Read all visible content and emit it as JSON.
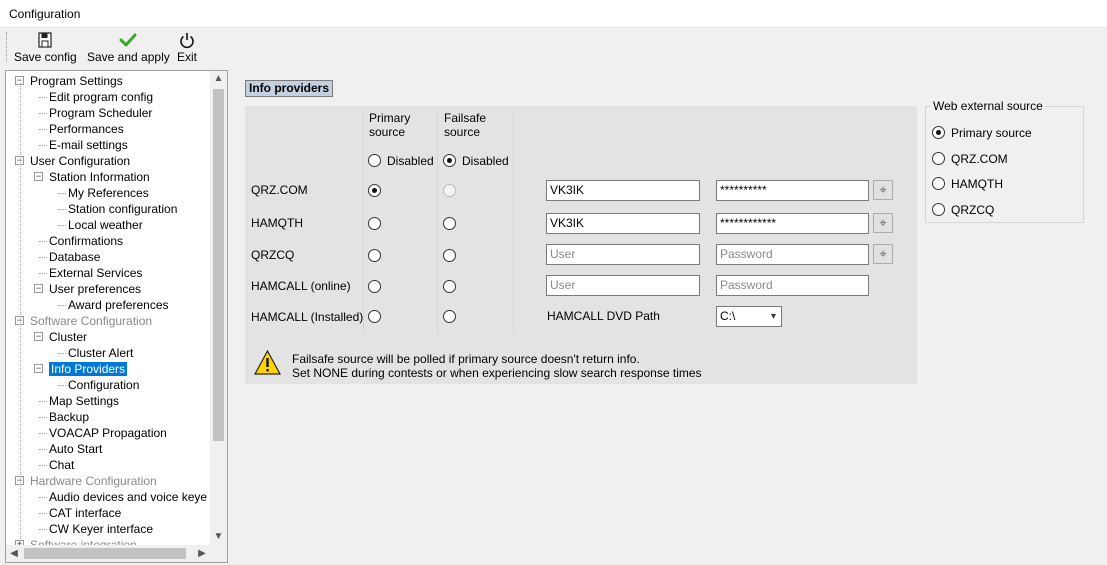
{
  "window": {
    "title": "Configuration"
  },
  "toolbar": {
    "save_config": "Save config",
    "save_apply": "Save and apply",
    "exit": "Exit"
  },
  "tree": {
    "items": [
      {
        "label": "Program Settings",
        "level": 0,
        "expander": "−",
        "style": "normal"
      },
      {
        "label": "Edit program config",
        "level": 1
      },
      {
        "label": "Program Scheduler",
        "level": 1
      },
      {
        "label": "Performances",
        "level": 1
      },
      {
        "label": "E-mail settings",
        "level": 1
      },
      {
        "label": "User Configuration",
        "level": 0,
        "expander": "−"
      },
      {
        "label": "Station Information",
        "level": 1,
        "expander": "−"
      },
      {
        "label": "My References",
        "level": 2
      },
      {
        "label": "Station configuration",
        "level": 2
      },
      {
        "label": "Local weather",
        "level": 2
      },
      {
        "label": "Confirmations",
        "level": 1
      },
      {
        "label": "Database",
        "level": 1
      },
      {
        "label": "External Services",
        "level": 1
      },
      {
        "label": "User preferences",
        "level": 1,
        "expander": "−"
      },
      {
        "label": "Award preferences",
        "level": 2
      },
      {
        "label": "Software Configuration",
        "level": 0,
        "expander": "−",
        "style": "gray"
      },
      {
        "label": "Cluster",
        "level": 1,
        "expander": "−"
      },
      {
        "label": "Cluster Alert",
        "level": 2
      },
      {
        "label": "Info Providers",
        "level": 1,
        "expander": "−",
        "style": "selected"
      },
      {
        "label": "Configuration",
        "level": 2
      },
      {
        "label": "Map Settings",
        "level": 1
      },
      {
        "label": "Backup",
        "level": 1
      },
      {
        "label": "VOACAP Propagation",
        "level": 1
      },
      {
        "label": "Auto Start",
        "level": 1
      },
      {
        "label": "Chat",
        "level": 1
      },
      {
        "label": "Hardware Configuration",
        "level": 0,
        "expander": "−",
        "style": "gray"
      },
      {
        "label": "Audio devices and voice keye",
        "level": 1
      },
      {
        "label": "CAT interface",
        "level": 1
      },
      {
        "label": "CW Keyer interface",
        "level": 1
      },
      {
        "label": "Software integration",
        "level": 0,
        "expander": "+",
        "style": "gray"
      }
    ]
  },
  "info_providers": {
    "section_title": "Info providers",
    "primary_header": "Primary\nsource",
    "failsafe_header": "Failsafe\nsource",
    "disabled_label": "Disabled",
    "providers": [
      {
        "name": "QRZ.COM",
        "primary": true,
        "failsafe_disabled": true,
        "user": "VK3IK",
        "user_placeholder": "",
        "password": "**********",
        "password_placeholder": "",
        "has_picker": true
      },
      {
        "name": "HAMQTH",
        "primary": false,
        "user": "VK3IK",
        "user_placeholder": "",
        "password": "************",
        "password_placeholder": "",
        "has_picker": true
      },
      {
        "name": "QRZCQ",
        "primary": false,
        "user": "",
        "user_placeholder": "User",
        "password": "",
        "password_placeholder": "Password",
        "has_picker": true
      },
      {
        "name": "HAMCALL (online)",
        "primary": false,
        "user": "",
        "user_placeholder": "User",
        "password": "",
        "password_placeholder": "Password",
        "has_picker": false
      },
      {
        "name": "HAMCALL (Installed)",
        "primary": false,
        "dvd_label": "HAMCALL DVD Path",
        "dvd_value": "C:\\"
      }
    ],
    "note_line1": "Failsafe source will be polled if primary source doesn't return info.",
    "note_line2": "Set NONE during contests or when experiencing slow search response times"
  },
  "web_external": {
    "title": "Web external source",
    "options": [
      "Primary source",
      "QRZ.COM",
      "HAMQTH",
      "QRZCQ"
    ],
    "selected": 0
  },
  "icons": {
    "save": "floppy-icon",
    "apply": "check-icon",
    "exit": "power-icon",
    "warning": "warning-icon",
    "picker": "target-icon"
  },
  "colors": {
    "selection": "#0078d7",
    "section_title_bg": "#c4cfe0",
    "panel_bg": "#e3e3e3",
    "check_green": "#3aa62a"
  }
}
